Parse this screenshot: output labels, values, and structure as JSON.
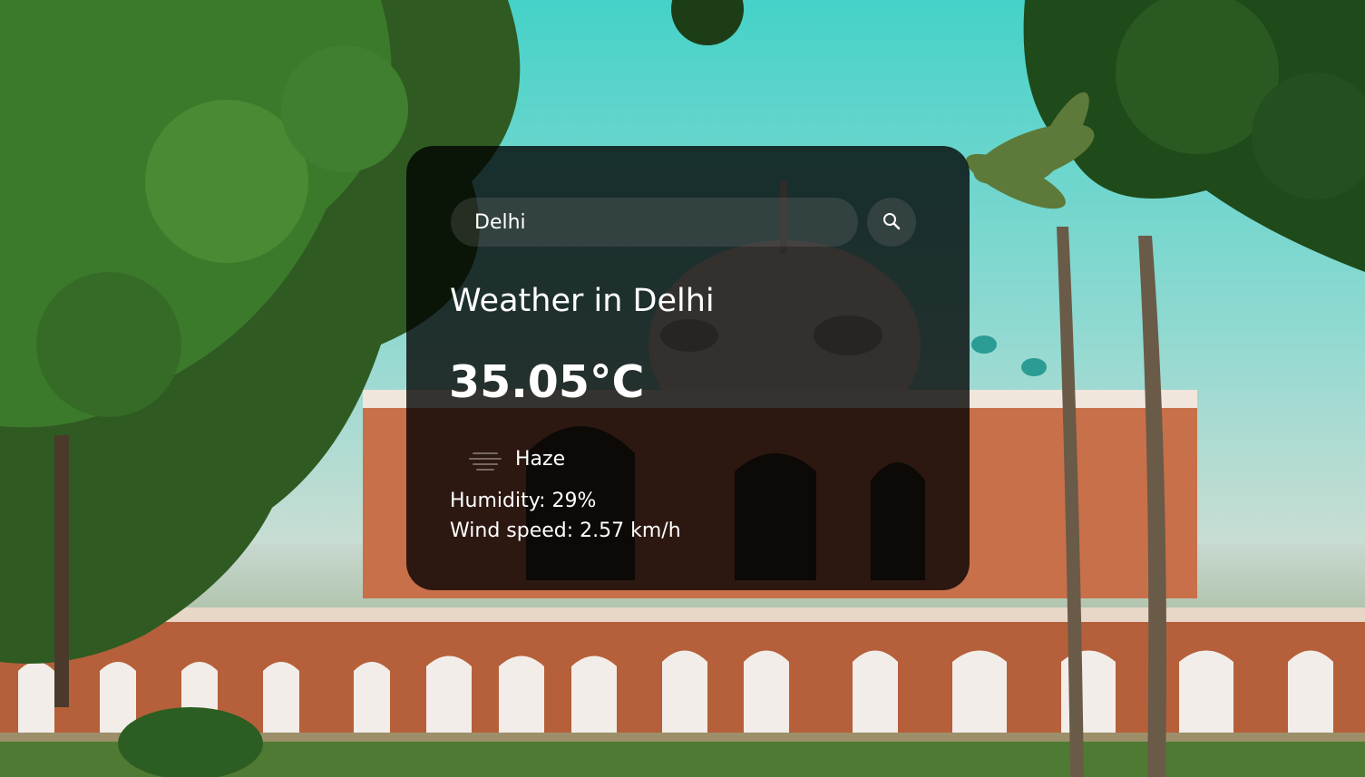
{
  "search": {
    "value": "Delhi",
    "button_icon": "search-icon"
  },
  "weather": {
    "title": "Weather in Delhi",
    "temperature": "35.05°C",
    "icon": "haze-icon",
    "description": "Haze",
    "humidity": "Humidity: 29%",
    "wind": "Wind speed: 2.57 km/h"
  },
  "colors": {
    "card_bg": "#000000",
    "text": "#ffffff",
    "sky": "#4fd3c9",
    "sandstone": "#b5603a"
  }
}
